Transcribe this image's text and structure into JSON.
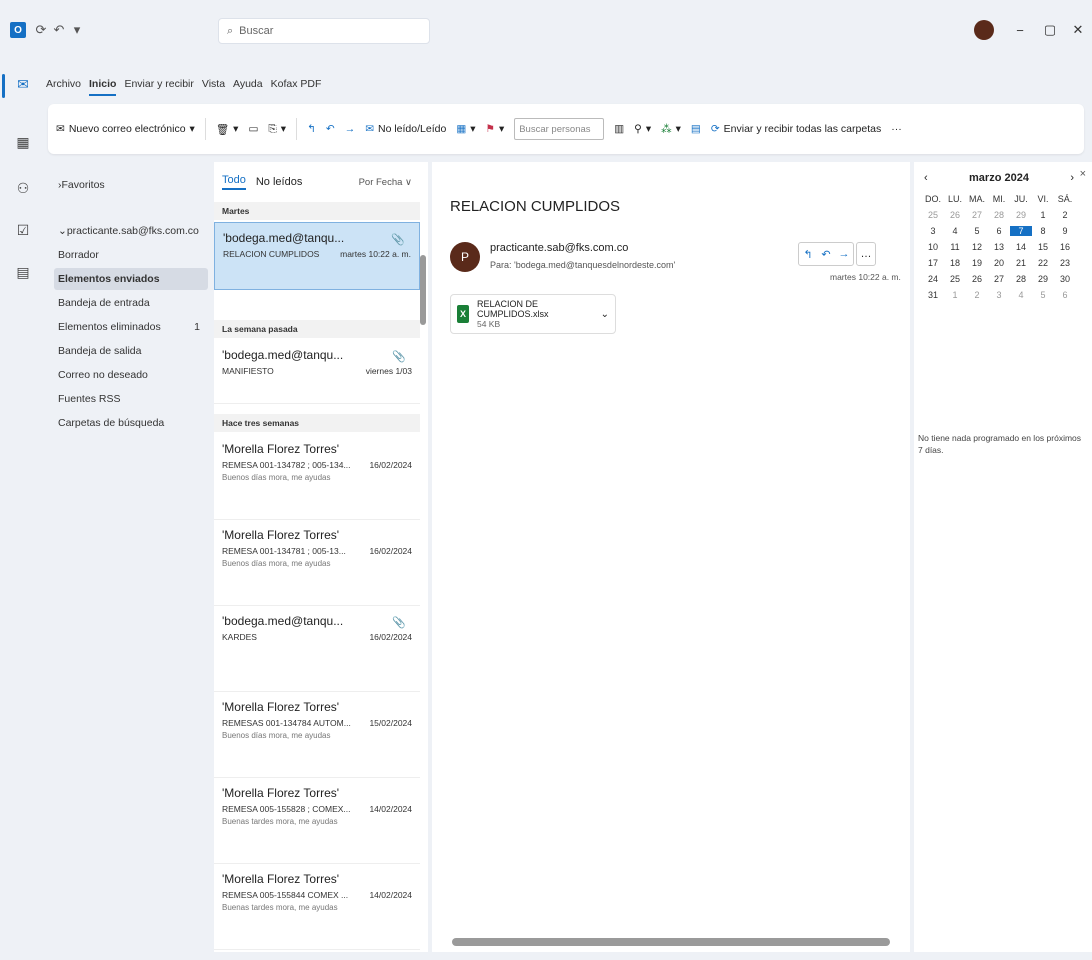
{
  "titlebar": {
    "search_placeholder": "Buscar",
    "icons": [
      "outlook-app-icon",
      "sync-icon",
      "undo-icon",
      "more-icon"
    ]
  },
  "menu": [
    "Archivo",
    "Inicio",
    "Enviar y recibir",
    "Vista",
    "Ayuda",
    "Kofax PDF"
  ],
  "ribbon": {
    "new_mail": "Nuevo correo electrónico",
    "read_unread": "No leído/Leído",
    "search_people": "Buscar personas",
    "send_receive_all": "Enviar y recibir todas las carpetas",
    "more": "···"
  },
  "folders": {
    "favorites": "Favoritos",
    "account": "practicante.sab@fks.com.co",
    "items": [
      {
        "label": "Borrador",
        "count": ""
      },
      {
        "label": "Elementos enviados",
        "count": ""
      },
      {
        "label": "Bandeja de entrada",
        "count": ""
      },
      {
        "label": "Elementos eliminados",
        "count": "1"
      },
      {
        "label": "Bandeja de salida",
        "count": ""
      },
      {
        "label": "Correo no deseado",
        "count": ""
      },
      {
        "label": "Fuentes RSS",
        "count": ""
      },
      {
        "label": "Carpetas de búsqueda",
        "count": ""
      }
    ]
  },
  "msglist": {
    "tab_all": "Todo",
    "tab_unread": "No leídos",
    "sort": "Por Fecha ∨",
    "groups": [
      "Martes",
      "La semana pasada",
      "Hace tres semanas"
    ],
    "messages": [
      {
        "from": "'bodega.med@tanqu...",
        "subject": "RELACION CUMPLIDOS",
        "date": "martes 10:22 a. m.",
        "preview": ""
      },
      {
        "from": "'bodega.med@tanqu...",
        "subject": "MANIFIESTO",
        "date": "viernes 1/03",
        "preview": ""
      },
      {
        "from": "'Morella Florez Torres'",
        "subject": "REMESA 001-134782 ; 005-134...",
        "date": "16/02/2024",
        "preview": "Buenos días mora, me ayudas"
      },
      {
        "from": "'Morella Florez Torres'",
        "subject": "REMESA 001-134781 ; 005-13...",
        "date": "16/02/2024",
        "preview": "Buenos días mora, me ayudas"
      },
      {
        "from": "'bodega.med@tanqu...",
        "subject": "KARDES",
        "date": "16/02/2024",
        "preview": ""
      },
      {
        "from": "'Morella Florez Torres'",
        "subject": "REMESAS 001-134784 AUTOM...",
        "date": "15/02/2024",
        "preview": "Buenos días mora, me ayudas"
      },
      {
        "from": "'Morella Florez Torres'",
        "subject": "REMESA 005-155828 ; COMEX...",
        "date": "14/02/2024",
        "preview": "Buenas tardes mora, me ayudas"
      },
      {
        "from": "'Morella Florez Torres'",
        "subject": "REMESA 005-155844 COMEX ...",
        "date": "14/02/2024",
        "preview": "Buenas tardes mora, me ayudas"
      }
    ]
  },
  "reading": {
    "subject": "RELACION CUMPLIDOS",
    "avatar_letter": "P",
    "from": "practicante.sab@fks.com.co",
    "to": "Para: 'bodega.med@tanquesdelnordeste.com'",
    "time": "martes 10:22 a. m.",
    "attachment_name": "RELACION DE CUMPLIDOS.xlsx",
    "attachment_size": "54 KB"
  },
  "calendar": {
    "month": "marzo 2024",
    "weekdays": [
      "DO.",
      "LU.",
      "MA.",
      "MI.",
      "JU.",
      "VI.",
      "SÁ."
    ],
    "days": [
      [
        "25",
        "26",
        "27",
        "28",
        "29",
        "1",
        "2"
      ],
      [
        "3",
        "4",
        "5",
        "6",
        "7",
        "8",
        "9"
      ],
      [
        "10",
        "11",
        "12",
        "13",
        "14",
        "15",
        "16"
      ],
      [
        "17",
        "18",
        "19",
        "20",
        "21",
        "22",
        "23"
      ],
      [
        "24",
        "25",
        "26",
        "27",
        "28",
        "29",
        "30"
      ],
      [
        "31",
        "1",
        "2",
        "3",
        "4",
        "5",
        "6"
      ]
    ],
    "today": "7",
    "note": "No tiene nada programado en los próximos 7 días."
  },
  "colors": {
    "accent": "#1570c4",
    "selected_row": "#cce3f6",
    "avatar": "#5a2a1a",
    "excel": "#1a7f37"
  }
}
